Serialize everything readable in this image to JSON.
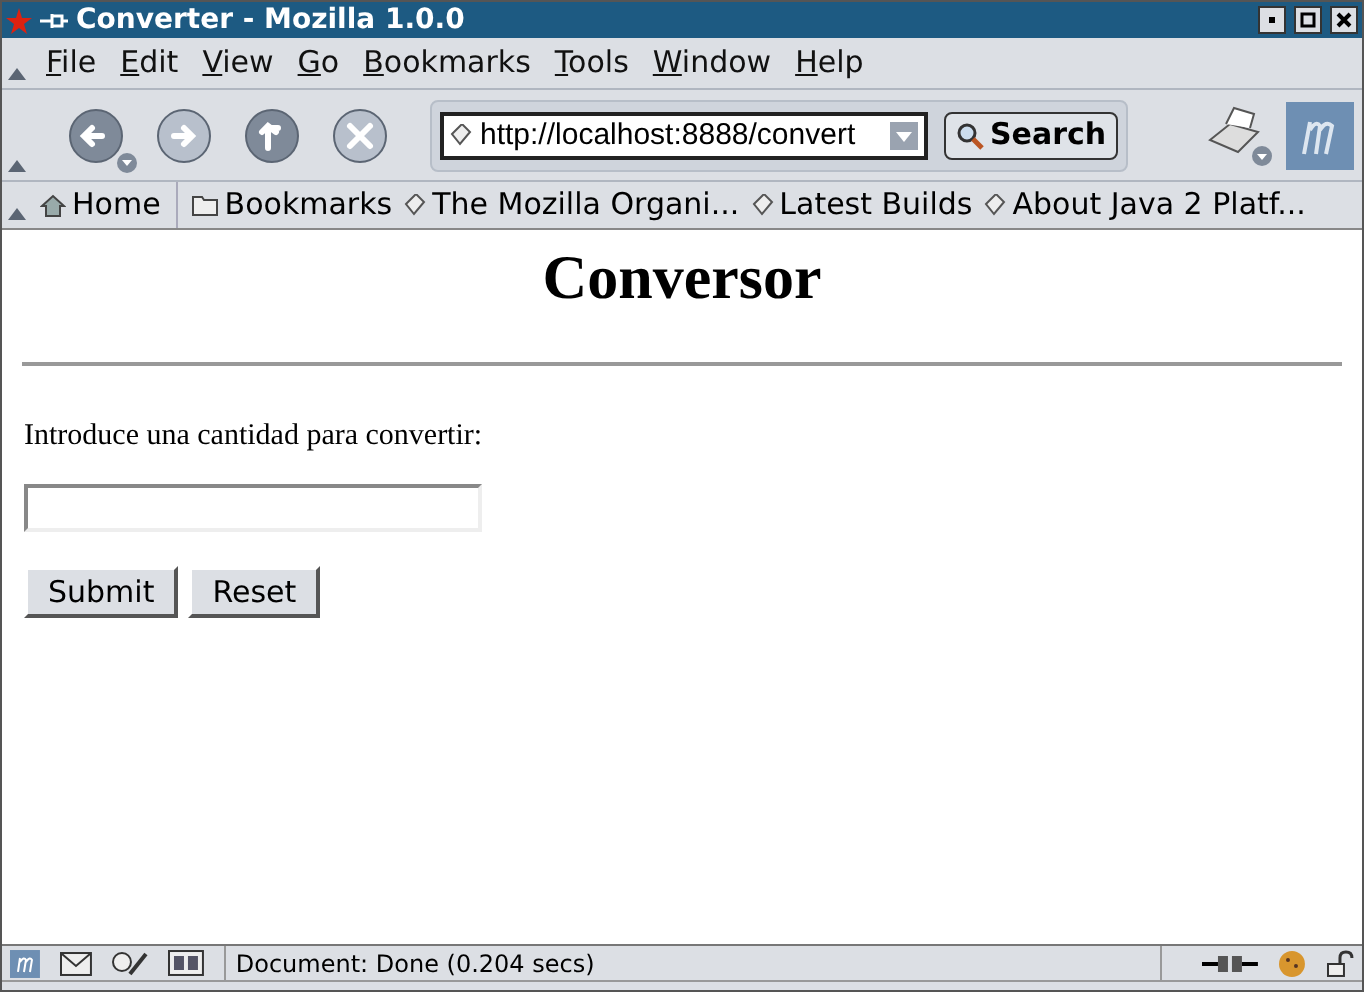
{
  "window": {
    "title": "Converter - Mozilla 1.0.0"
  },
  "menu": [
    "File",
    "Edit",
    "View",
    "Go",
    "Bookmarks",
    "Tools",
    "Window",
    "Help"
  ],
  "navigation": {
    "url": "http://localhost:8888/convert",
    "search_button": "Search"
  },
  "bookmarks": [
    {
      "label": "Home",
      "kind": "home"
    },
    {
      "label": "Bookmarks",
      "kind": "folder"
    },
    {
      "label": "The Mozilla Organi...",
      "kind": "link"
    },
    {
      "label": "Latest Builds",
      "kind": "link"
    },
    {
      "label": "About Java 2 Platf...",
      "kind": "link"
    }
  ],
  "page": {
    "heading": "Conversor",
    "prompt": "Introduce una cantidad para convertir:",
    "buttons": [
      "Submit",
      "Reset"
    ]
  },
  "status_bar": {
    "text": "Document: Done (0.204 secs)"
  }
}
